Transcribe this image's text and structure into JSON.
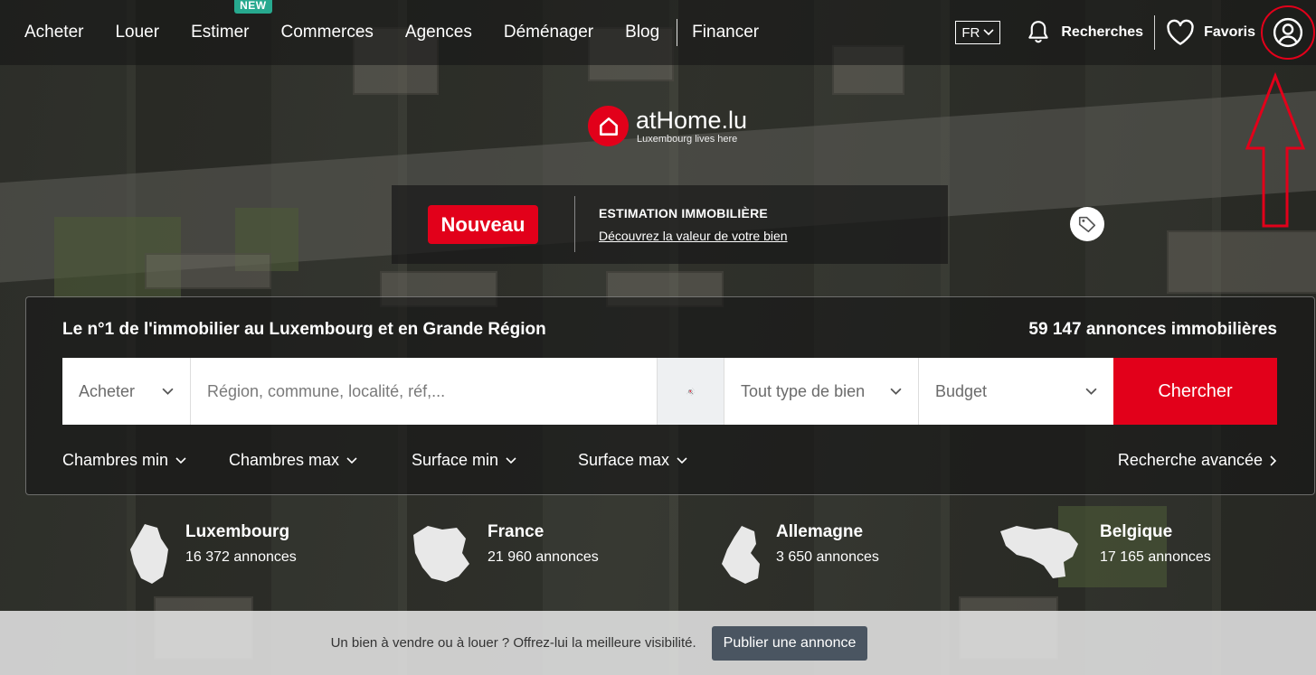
{
  "nav": {
    "items": [
      {
        "label": "Acheter"
      },
      {
        "label": "Louer"
      },
      {
        "label": "Estimer",
        "badge": "NEW"
      },
      {
        "label": "Commerces"
      },
      {
        "label": "Agences"
      },
      {
        "label": "Déménager"
      },
      {
        "label": "Blog"
      },
      {
        "label": "Financer"
      }
    ],
    "language": "FR",
    "searches_label": "Recherches",
    "favorites_label": "Favoris",
    "icons": [
      "bell-icon",
      "heart-icon",
      "user-account-icon",
      "chevron-down-icon"
    ]
  },
  "logo": {
    "name": "atHome.lu",
    "tagline": "Luxembourg lives here"
  },
  "promo": {
    "badge": "Nouveau",
    "title": "ESTIMATION IMMOBILIÈRE",
    "link": "Découvrez la valeur de votre bien"
  },
  "search": {
    "headline": "Le n°1 de l'immobilier au Luxembourg et en Grande Région",
    "count": "59 147 annonces immobilières",
    "mode": "Acheter",
    "location_placeholder": "Région, commune, localité, réf,...",
    "property_type": "Tout type de bien",
    "budget": "Budget",
    "submit": "Chercher",
    "filters": {
      "rooms_min": "Chambres min",
      "rooms_max": "Chambres max",
      "surface_min": "Surface min",
      "surface_max": "Surface max",
      "advanced": "Recherche avancée"
    }
  },
  "countries": [
    {
      "name": "Luxembourg",
      "count": "16 372 annonces"
    },
    {
      "name": "France",
      "count": "21 960 annonces"
    },
    {
      "name": "Allemagne",
      "count": "3 650 annonces"
    },
    {
      "name": "Belgique",
      "count": "17 165 annonces"
    }
  ],
  "bottom_bar": {
    "text": "Un bien à vendre ou à louer ? Offrez-lui la meilleure visibilité.",
    "button": "Publier une annonce"
  },
  "colors": {
    "brand_red": "#e2001a",
    "badge_green": "#27a98f",
    "publish_button": "#4a5561"
  }
}
